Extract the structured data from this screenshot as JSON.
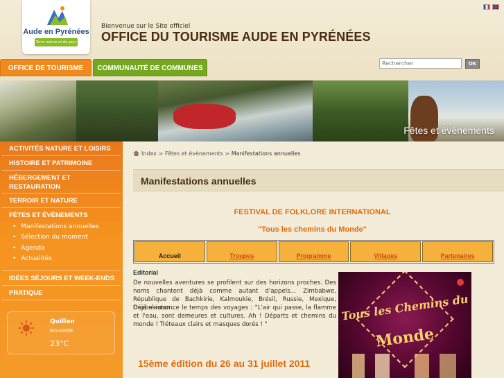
{
  "header": {
    "logo_name": "Aude en Pyrénées",
    "logo_tagline": "Terre nature et de pays cathares",
    "welcome": "Bienvenue sur le Site officiel",
    "title": "OFFICE DU TOURISME AUDE EN PYRÉNÉES",
    "languages": [
      "fr-flag-icon",
      "en-flag-icon"
    ]
  },
  "nav": {
    "tabs": [
      {
        "label": "OFFICE DE TOURISME",
        "color": "#f08a1c"
      },
      {
        "label": "COMMUNAUTÉ DE COMMUNES",
        "color": "#74a91f"
      }
    ]
  },
  "search": {
    "placeholder": "Rechercher",
    "button_label": "OK"
  },
  "banner": {
    "caption": "Fêtes et évènements"
  },
  "sidebar": {
    "items": [
      {
        "label": "ACTIVITÉS NATURE ET LOISIRS"
      },
      {
        "label": "HISTOIRE ET PATRIMOINE"
      },
      {
        "label": "HÉBERGEMENT ET"
      },
      {
        "label": "RESTAURATION"
      },
      {
        "label": "TERROIR ET NATURE"
      },
      {
        "label": "FÊTES ET ÉVÈNEMENTS"
      },
      {
        "label": "IDÉES SÉJOURS ET WEEK-ENDS"
      },
      {
        "label": "PRATIQUE"
      }
    ],
    "subitems": [
      {
        "label": "Manifestations annuelles"
      },
      {
        "label": "Sélection du moment"
      },
      {
        "label": "Agenda"
      },
      {
        "label": "Actualités"
      }
    ],
    "weather": {
      "city": "Quillan",
      "condition": "Ensoleillé",
      "temperature": "23°C",
      "icon": "sun-icon"
    }
  },
  "main": {
    "breadcrumb": {
      "home": "Index",
      "sep": ">",
      "section": "Fêtes et évènements",
      "current": "Manifestations annuelles"
    },
    "heading": "Manifestations annuelles",
    "festival_title": "FESTIVAL DE FOLKLORE INTERNATIONAL",
    "festival_subtitle": "\"Tous les chemins du Monde\"",
    "menu": [
      {
        "label": "Accueil",
        "active": true
      },
      {
        "label": "Troupes"
      },
      {
        "label": "Programme"
      },
      {
        "label": "Villages"
      },
      {
        "label": "Partenaires"
      }
    ],
    "editorial_heading": "Editorial",
    "editorial_p1": "De nouvelles aventures se profilent sur des horizons proches. Des noms chantent déjà comme autant d'appels… Zimbabwe, République de Bachkirie, Kalmoukie, Brésil, Russie, Mexique, Ouzbekistan ..",
    "editorial_p2": "Déjà s'annonce le temps des voyages : \"L'air qui passe, la flamme et l'eau, sont demeures et cultures. Ah ! Départs et chemins du monde ! Tréteaux clairs et masques dorés ! \"",
    "edition": "15ème édition du 26 au 31 juillet 2011",
    "poster": {
      "line1": "Tous les Chemins du",
      "line2": "Monde"
    }
  }
}
